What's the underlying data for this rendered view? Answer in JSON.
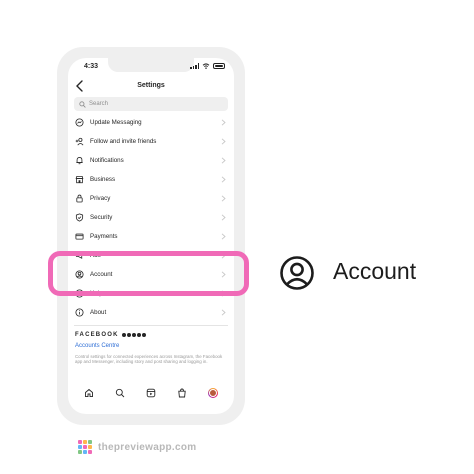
{
  "status_bar": {
    "time": "4:33"
  },
  "header": {
    "title": "Settings"
  },
  "search": {
    "placeholder": "Search"
  },
  "menu_items": [
    {
      "label": "Update Messaging",
      "icon": "messenger-icon"
    },
    {
      "label": "Follow and invite friends",
      "icon": "add-person-icon"
    },
    {
      "label": "Notifications",
      "icon": "bell-icon"
    },
    {
      "label": "Business",
      "icon": "shop-icon"
    },
    {
      "label": "Privacy",
      "icon": "lock-icon"
    },
    {
      "label": "Security",
      "icon": "shield-icon"
    },
    {
      "label": "Payments",
      "icon": "card-icon"
    },
    {
      "label": "Ads",
      "icon": "megaphone-icon"
    },
    {
      "label": "Account",
      "icon": "account-icon"
    },
    {
      "label": "Help",
      "icon": "help-icon"
    },
    {
      "label": "About",
      "icon": "info-icon"
    }
  ],
  "facebook_section": {
    "brand": "FACEBOOK",
    "accounts_centre": "Accounts Centre",
    "description": "Control settings for connected experiences across Instagram, the Facebook app and Messenger, including story and post sharing and logging in."
  },
  "callout": {
    "label": "Account",
    "icon": "account-circle-icon"
  },
  "watermark": {
    "text": "thepreviewapp.com"
  },
  "colors": {
    "highlight": "#f06ab7",
    "link": "#2f6fd6",
    "phone_frame": "#efefef"
  }
}
